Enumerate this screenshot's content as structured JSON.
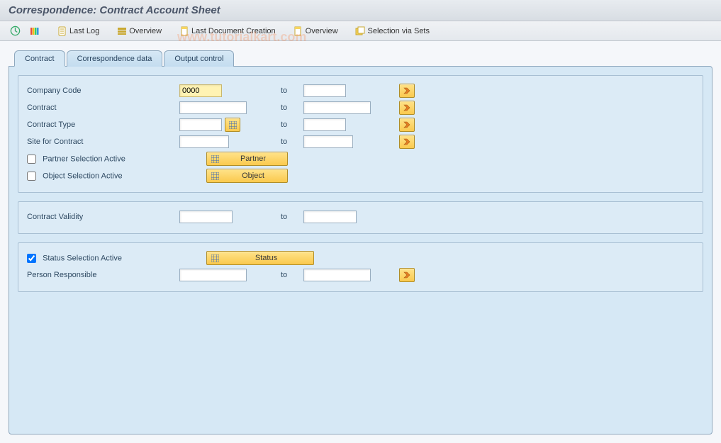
{
  "header": {
    "title": "Correspondence: Contract Account Sheet"
  },
  "toolbar": {
    "last_log": "Last Log",
    "overview1": "Overview",
    "last_doc": "Last Document Creation",
    "overview2": "Overview",
    "selection_via_sets": "Selection via Sets"
  },
  "tabs": {
    "contract": "Contract",
    "corr_data": "Correspondence data",
    "output": "Output control"
  },
  "group1": {
    "company_code_label": "Company Code",
    "company_code_value": "0000",
    "contract_label": "Contract",
    "contract_type_label": "Contract Type",
    "site_label": "Site for Contract",
    "partner_sel_label": "Partner Selection Active",
    "partner_btn": "Partner",
    "object_sel_label": "Object Selection Active",
    "object_btn": "Object",
    "to": "to"
  },
  "group2": {
    "validity_label": "Contract Validity",
    "to": "to"
  },
  "group3": {
    "status_sel_label": "Status Selection Active",
    "status_sel_checked": true,
    "status_btn": "Status",
    "person_label": "Person Responsible",
    "to": "to"
  },
  "watermark": "www.tutorialkart.com"
}
